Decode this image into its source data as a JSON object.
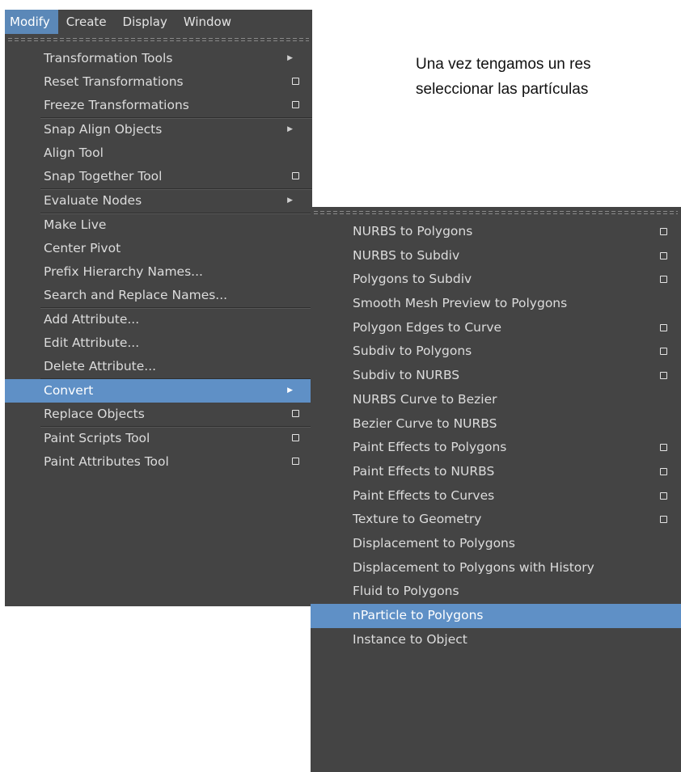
{
  "menubar": {
    "items": [
      "Modify",
      "Create",
      "Display",
      "Window"
    ]
  },
  "body_text": {
    "line1": "Una vez tengamos un res",
    "line2": "seleccionar las partículas"
  },
  "modify_menu": {
    "items": [
      {
        "label": "Transformation Tools",
        "submenu": true
      },
      {
        "label": "Reset Transformations",
        "option_box": true
      },
      {
        "label": "Freeze Transformations",
        "option_box": true
      },
      {
        "label": "Snap Align Objects",
        "submenu": true
      },
      {
        "label": "Align Tool"
      },
      {
        "label": "Snap Together Tool",
        "option_box": true
      },
      {
        "label": "Evaluate Nodes",
        "submenu": true
      },
      {
        "label": "Make Live"
      },
      {
        "label": "Center Pivot"
      },
      {
        "label": "Prefix Hierarchy Names..."
      },
      {
        "label": "Search and Replace Names..."
      },
      {
        "label": "Add Attribute..."
      },
      {
        "label": "Edit Attribute..."
      },
      {
        "label": "Delete Attribute..."
      },
      {
        "label": "Convert",
        "submenu": true,
        "highlighted": true
      },
      {
        "label": "Replace Objects",
        "option_box": true
      },
      {
        "label": "Paint Scripts Tool",
        "option_box": true
      },
      {
        "label": "Paint Attributes Tool",
        "option_box": true
      }
    ]
  },
  "convert_menu": {
    "items": [
      {
        "label": "NURBS to Polygons",
        "option_box": true
      },
      {
        "label": "NURBS to Subdiv",
        "option_box": true
      },
      {
        "label": "Polygons to Subdiv",
        "option_box": true
      },
      {
        "label": "Smooth Mesh Preview to Polygons"
      },
      {
        "label": "Polygon Edges to Curve",
        "option_box": true
      },
      {
        "label": "Subdiv to Polygons",
        "option_box": true
      },
      {
        "label": "Subdiv to NURBS",
        "option_box": true
      },
      {
        "label": "NURBS Curve to Bezier"
      },
      {
        "label": "Bezier Curve to NURBS"
      },
      {
        "label": "Paint Effects to Polygons",
        "option_box": true
      },
      {
        "label": "Paint Effects to NURBS",
        "option_box": true
      },
      {
        "label": "Paint Effects to Curves",
        "option_box": true
      },
      {
        "label": "Texture to Geometry",
        "option_box": true
      },
      {
        "label": "Displacement to Polygons"
      },
      {
        "label": "Displacement to Polygons with History"
      },
      {
        "label": "Fluid to Polygons"
      },
      {
        "label": "nParticle to Polygons",
        "highlighted": true
      },
      {
        "label": "Instance to Object"
      }
    ]
  },
  "colors": {
    "menu_bg": "#444444",
    "highlight": "#5f90c6",
    "text": "#dcdcdc"
  }
}
